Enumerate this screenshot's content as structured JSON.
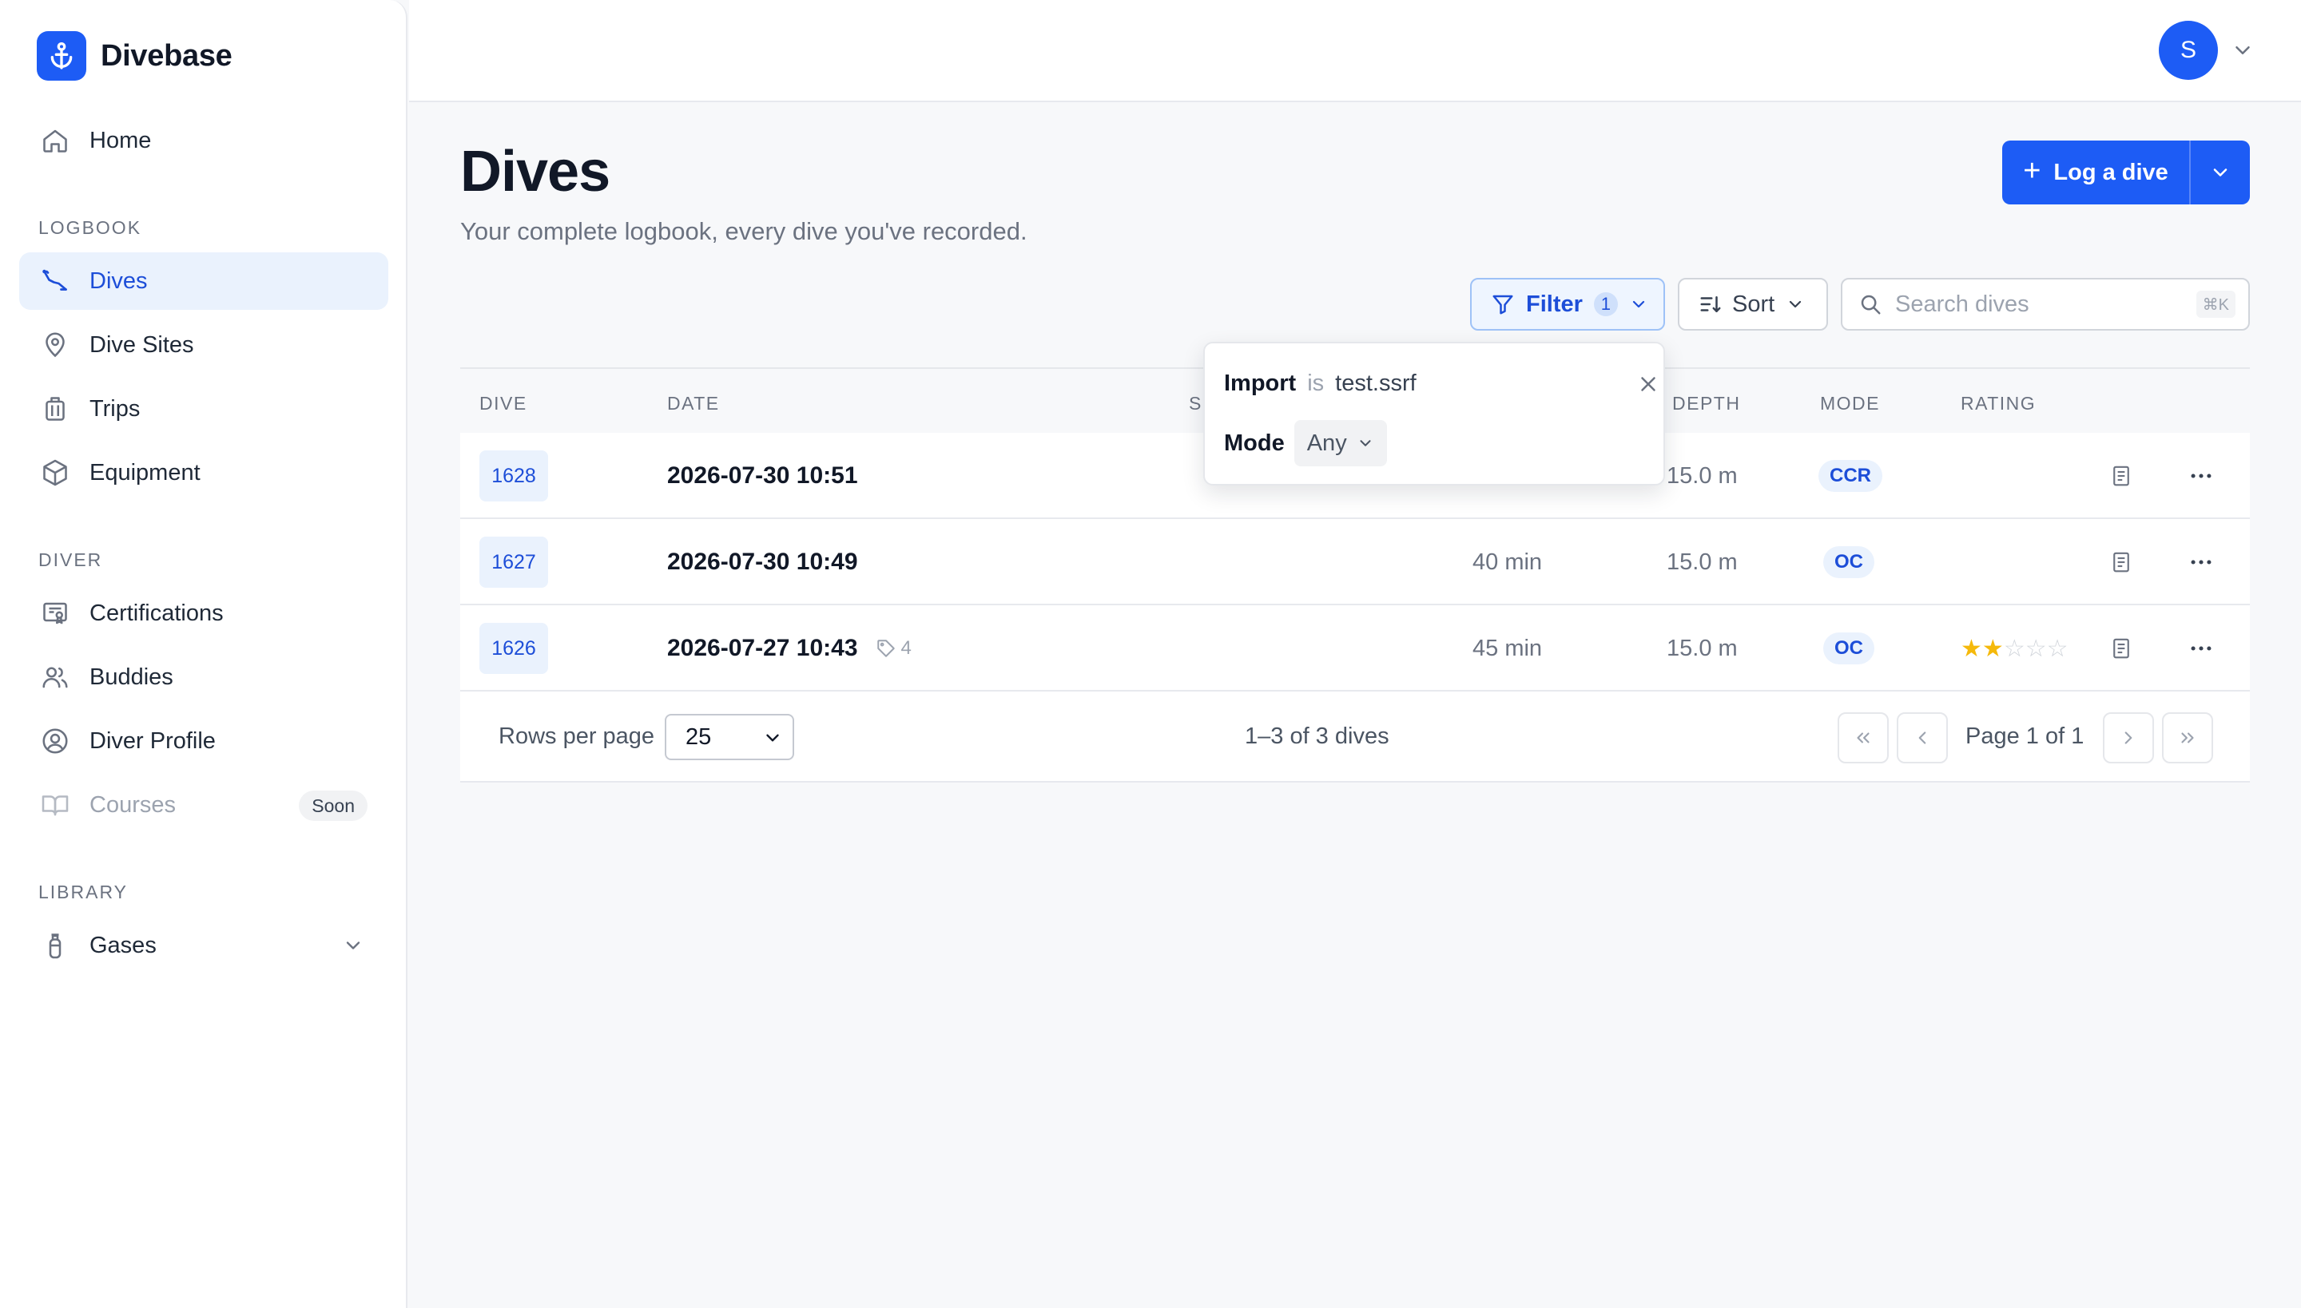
{
  "brand": {
    "name": "Divebase",
    "logo_icon": "anchor-icon",
    "accent": "#1d5cf5"
  },
  "sidebar": {
    "home": {
      "label": "Home",
      "icon": "home-icon"
    },
    "sections": {
      "logbook": "LOGBOOK",
      "diver": "DIVER",
      "library": "LIBRARY"
    },
    "logbook_items": [
      {
        "label": "Dives",
        "icon": "dive-path-icon",
        "active": true
      },
      {
        "label": "Dive Sites",
        "icon": "map-pin-icon"
      },
      {
        "label": "Trips",
        "icon": "luggage-icon"
      },
      {
        "label": "Equipment",
        "icon": "box-icon"
      }
    ],
    "diver_items": [
      {
        "label": "Certifications",
        "icon": "certificate-icon"
      },
      {
        "label": "Buddies",
        "icon": "users-icon"
      },
      {
        "label": "Diver Profile",
        "icon": "user-circle-icon"
      },
      {
        "label": "Courses",
        "icon": "book-icon",
        "badge": "Soon",
        "disabled": true
      }
    ],
    "library_items": [
      {
        "label": "Gases",
        "icon": "gas-tank-icon",
        "expandable": true
      }
    ]
  },
  "topbar": {
    "avatar_initial": "S"
  },
  "header": {
    "title": "Dives",
    "subtitle": "Your complete logbook, every dive you've recorded.",
    "log_button": "Log a dive"
  },
  "toolbar": {
    "filter_label": "Filter",
    "filter_count": "1",
    "sort_label": "Sort",
    "search_placeholder": "Search dives",
    "search_shortcut": "⌘K"
  },
  "filter_popover": {
    "field": "Import",
    "operator": "is",
    "value": "test.ssrf",
    "mode_label": "Mode",
    "mode_value": "Any"
  },
  "table": {
    "columns": [
      "DIVE",
      "DATE",
      "SI",
      "DEPTH",
      "MODE",
      "RATING"
    ],
    "rows": [
      {
        "dive": "1628",
        "date": "2026-07-30 10:51",
        "duration": "",
        "depth": "15.0 m",
        "mode": "CCR",
        "tags": "",
        "rating": 0
      },
      {
        "dive": "1627",
        "date": "2026-07-30 10:49",
        "duration": "40 min",
        "depth": "15.0 m",
        "mode": "OC",
        "tags": "",
        "rating": 0
      },
      {
        "dive": "1626",
        "date": "2026-07-27 10:43",
        "duration": "45 min",
        "depth": "15.0 m",
        "mode": "OC",
        "tags": "4",
        "rating": 2
      }
    ]
  },
  "pagination": {
    "rows_per_page_label": "Rows per page",
    "rows_per_page_value": "25",
    "rows_per_page_options": [
      "25"
    ],
    "count_text": "1–3 of 3 dives",
    "page_text": "Page 1 of 1"
  }
}
